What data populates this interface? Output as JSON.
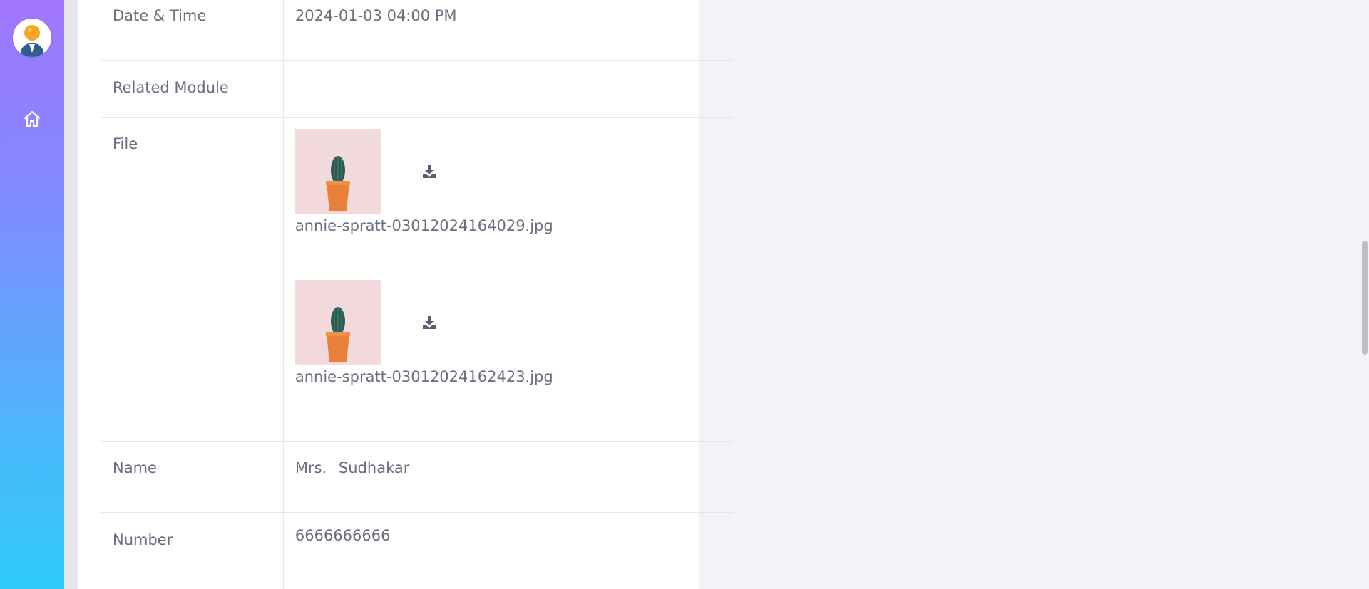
{
  "sidebar": {
    "avatar_icon": "user-avatar-icon",
    "home_icon": "home-icon"
  },
  "details": {
    "rows": {
      "datetime": {
        "label": "Date & Time",
        "value": "2024-01-03 04:00 PM"
      },
      "related_module": {
        "label": "Related Module",
        "value": ""
      },
      "file": {
        "label": "File",
        "files": [
          {
            "name": "annie-spratt-03012024164029.jpg"
          },
          {
            "name": "annie-spratt-03012024162423.jpg"
          }
        ]
      },
      "name": {
        "label": "Name",
        "title": "Mrs.",
        "value": "Sudhakar"
      },
      "number": {
        "label": "Number",
        "value": "6666666666"
      }
    }
  },
  "colors": {
    "sidebar_top": "#a276ff",
    "sidebar_bottom": "#2ecbf9",
    "text": "#6b6e7e",
    "background": "#f3f4f8"
  }
}
